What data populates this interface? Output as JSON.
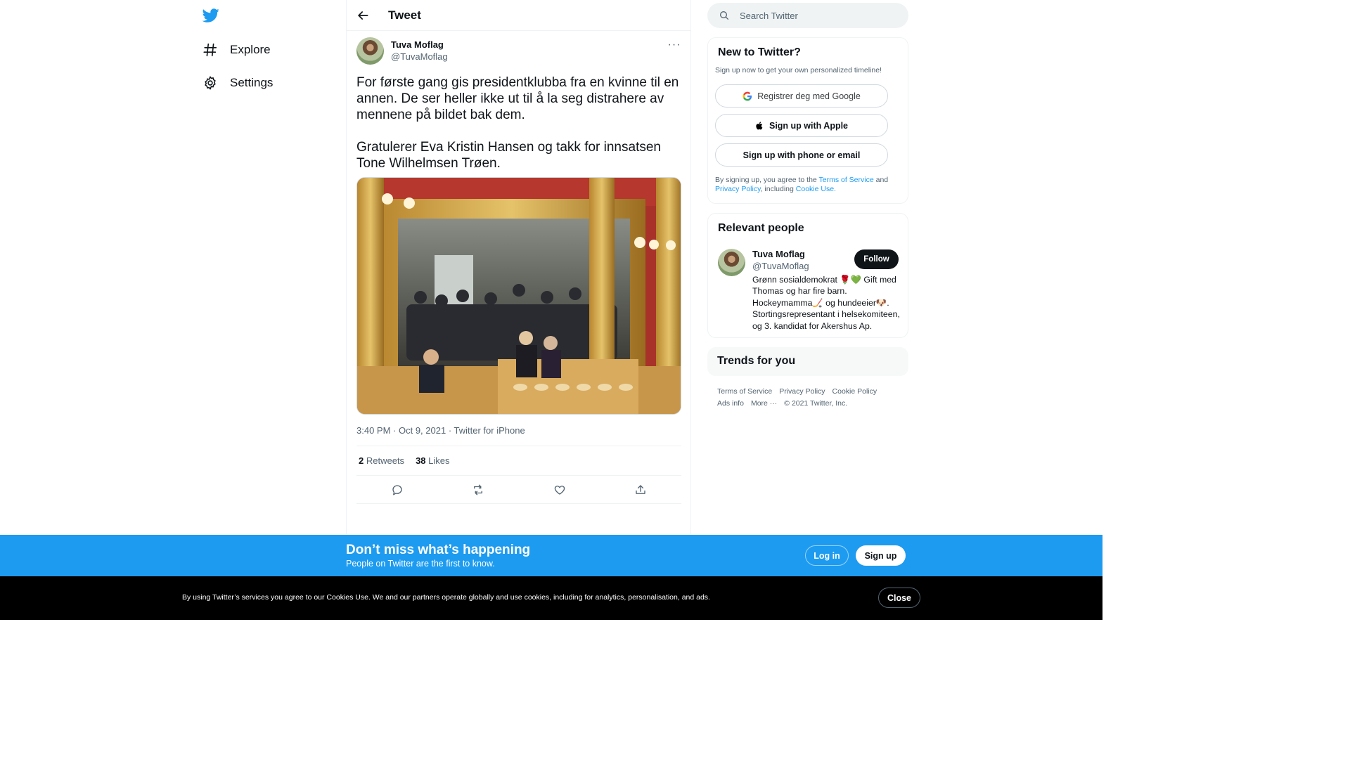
{
  "nav": {
    "items": [
      {
        "label": "Explore",
        "icon": "hashtag-icon"
      },
      {
        "label": "Settings",
        "icon": "gear-icon"
      }
    ]
  },
  "header": {
    "title": "Tweet"
  },
  "tweet": {
    "author_name": "Tuva Moflag",
    "author_handle": "@TuvaMoflag",
    "more": "···",
    "text": "For første gang gis presidentklubba fra en kvinne til en annen. De ser heller ikke ut til å la seg distrahere av mennene på bildet bak dem.\n\nGratulerer Eva Kristin Hansen og takk for innsatsen Tone Wilhelmsen Trøen.",
    "time": "3:40 PM",
    "date": "Oct 9, 2021",
    "client": "Twitter for iPhone",
    "retweets_count": "2",
    "retweets_label": "Retweets",
    "likes_count": "38",
    "likes_label": "Likes"
  },
  "search": {
    "placeholder": "Search Twitter"
  },
  "new_to_twitter": {
    "title": "New to Twitter?",
    "subtitle": "Sign up now to get your own personalized timeline!",
    "google_label": "Registrer deg med Google",
    "apple_label": "Sign up with Apple",
    "phone_label": "Sign up with phone or email",
    "terms_prefix": "By signing up, you agree to the",
    "terms_link": "Terms of Service",
    "terms_and": "and",
    "privacy_link": "Privacy Policy",
    "including": ", including",
    "cookie_link": "Cookie Use."
  },
  "relevant": {
    "title": "Relevant people",
    "name": "Tuva Moflag",
    "handle": "@TuvaMoflag",
    "follow_label": "Follow",
    "bio": "Grønn sosialdemokrat 🌹💚 Gift med Thomas og har fire barn. Hockeymamma🏒 og hundeeier🐶. Stortingsrepresentant i helsekomiteen, og 3. kandidat for Akershus Ap."
  },
  "trends": {
    "title": "Trends for you"
  },
  "footer": {
    "links": [
      "Terms of Service",
      "Privacy Policy",
      "Cookie Policy",
      "Ads info",
      "More ···",
      "© 2021 Twitter, Inc."
    ]
  },
  "banner": {
    "title": "Don’t miss what’s happening",
    "subtitle": "People on Twitter are the first to know.",
    "login_label": "Log in",
    "signup_label": "Sign up"
  },
  "cookie": {
    "text": "By using Twitter’s services you agree to our Cookies Use. We and our partners operate globally and use cookies, including for analytics, personalisation, and ads.",
    "close_label": "Close"
  },
  "colors": {
    "brand": "#1d9bf0",
    "text": "#0f1419",
    "muted": "#536471"
  }
}
